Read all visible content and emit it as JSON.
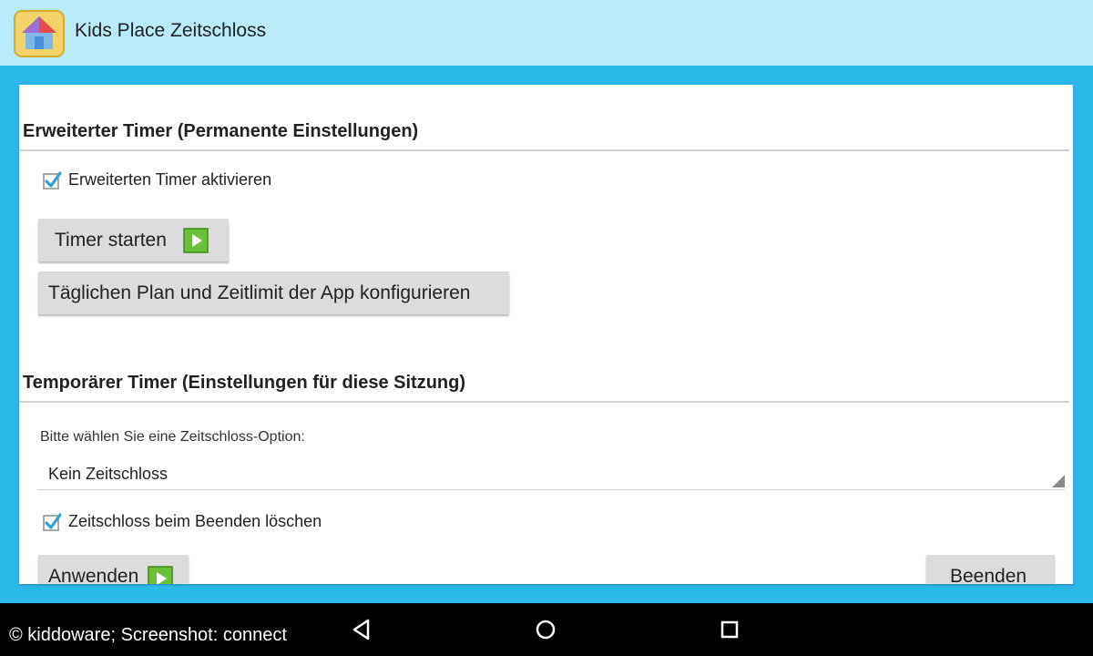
{
  "app": {
    "title": "Kids Place Zeitschloss",
    "icon": "kids-place-house-icon"
  },
  "advanced": {
    "header": "Erweiterter Timer (Permanente Einstellungen)",
    "enable_checkbox": {
      "label": "Erweiterten Timer aktivieren",
      "checked": true
    },
    "start_button": {
      "label": "Timer starten",
      "icon": "play-icon"
    },
    "configure_button": {
      "label": "Täglichen Plan und Zeitlimit der App konfigurieren"
    }
  },
  "temporary": {
    "header": "Temporärer Timer (Einstellungen für diese Sitzung)",
    "hint": "Bitte wählen Sie eine Zeitschloss-Option:",
    "dropdown": {
      "selected": "Kein Zeitschloss"
    },
    "clear_checkbox": {
      "label": "Zeitschloss beim Beenden löschen",
      "checked": true
    },
    "apply_button": {
      "label": "Anwenden",
      "icon": "play-icon"
    },
    "exit_button": {
      "label": "Beenden"
    }
  },
  "footer": {
    "copyright": "© kiddoware; Screenshot: connect"
  },
  "navbar": {
    "back": "back-icon",
    "home": "home-icon",
    "recents": "recents-icon"
  },
  "colors": {
    "accent": "#2bb7e8",
    "titlebar": "#b9ecfb",
    "checkbox": "#2ea0d6",
    "play": "#6cc13a"
  }
}
